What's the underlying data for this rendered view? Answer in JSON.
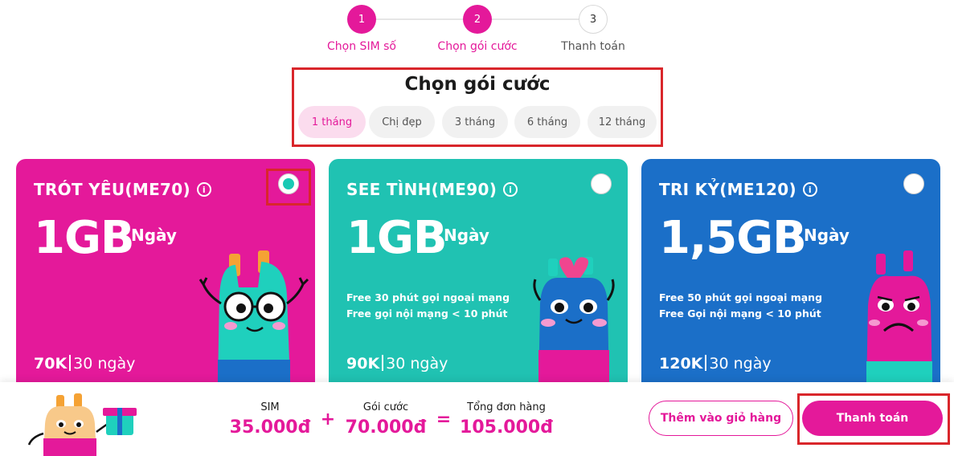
{
  "stepper": {
    "steps": [
      {
        "number": "1",
        "label": "Chọn SIM số"
      },
      {
        "number": "2",
        "label": "Chọn gói cước"
      },
      {
        "number": "3",
        "label": "Thanh toán"
      }
    ],
    "current_step": 2
  },
  "plan_selector": {
    "title": "Chọn gói cước",
    "tabs": [
      "1 tháng",
      "Chị đẹp",
      "3 tháng",
      "6 tháng",
      "12 tháng"
    ],
    "active_tab": "1 tháng"
  },
  "cards": [
    {
      "name": "TRÓT YÊU(ME70)",
      "data": "1GB",
      "unit": "Ngày",
      "perks": [],
      "price": "70K",
      "period": "30 ngày",
      "color": "#e4199a",
      "selected": true
    },
    {
      "name": "SEE TÌNH(ME90)",
      "data": "1GB",
      "unit": "Ngày",
      "perks": [
        "Free 30 phút gọi ngoại mạng",
        "Free gọi nội mạng < 10 phút"
      ],
      "price": "90K",
      "period": "30 ngày",
      "color": "#20c2b2",
      "selected": false
    },
    {
      "name": "TRI KỶ(ME120)",
      "data": "1,5GB",
      "unit": "Ngày",
      "perks": [
        "Free 50 phút gọi ngoại mạng",
        "Free Gọi nội mạng < 10 phút"
      ],
      "price": "120K",
      "period": "30 ngày",
      "color": "#1b6fc8",
      "selected": false
    }
  ],
  "summary": {
    "sim_label": "SIM",
    "sim_value": "35.000đ",
    "plan_label": "Gói cước",
    "plan_value": "70.000đ",
    "total_label": "Tổng đơn hàng",
    "total_value": "105.000đ",
    "plus": "+",
    "equals": "="
  },
  "actions": {
    "add_to_cart": "Thêm vào giỏ hàng",
    "checkout": "Thanh toán"
  },
  "icons": {
    "info": "info-icon",
    "radio": "radio-icon"
  },
  "colors": {
    "brand": "#e4199a",
    "highlight_border": "#d9262b"
  }
}
